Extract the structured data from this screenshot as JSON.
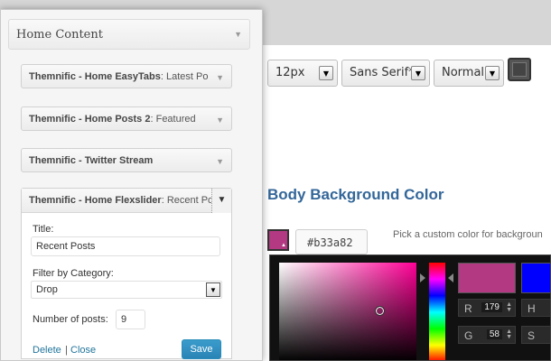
{
  "typography": {
    "size_value": "12px",
    "font_value": "Sans Serif*",
    "weight_value": "Normal"
  },
  "body_bg": {
    "title": "Body Background Color",
    "hex_value": "#b33a82",
    "help_text": "Pick a custom color for backgroun",
    "color": "#b33a82"
  },
  "picker": {
    "r_label": "R",
    "r_value": "179",
    "g_label": "G",
    "g_value": "58",
    "h_label": "H",
    "s_label": "S",
    "current_color": "#0000ff"
  },
  "widgets_panel": {
    "title": "Home Content",
    "widgets": [
      {
        "name": "Themnific - Home EasyTabs",
        "sub": ": Latest Po"
      },
      {
        "name": "Themnific - Home Posts 2",
        "sub": ": Featured"
      },
      {
        "name": "Themnific - Twitter Stream",
        "sub": ""
      }
    ],
    "open_widget": {
      "name": "Themnific - Home Flexslider",
      "sub": ": Recent Po",
      "title_label": "Title:",
      "title_value": "Recent Posts",
      "filter_label": "Filter by Category:",
      "filter_value": "Drop",
      "posts_label": "Number of posts:",
      "posts_value": "9",
      "delete_label": "Delete",
      "separator": "|",
      "close_label": "Close",
      "save_label": "Save"
    }
  },
  "icons": {
    "caret": "▼",
    "dropdown_arrow": "▼",
    "spinner": "▲▼"
  }
}
